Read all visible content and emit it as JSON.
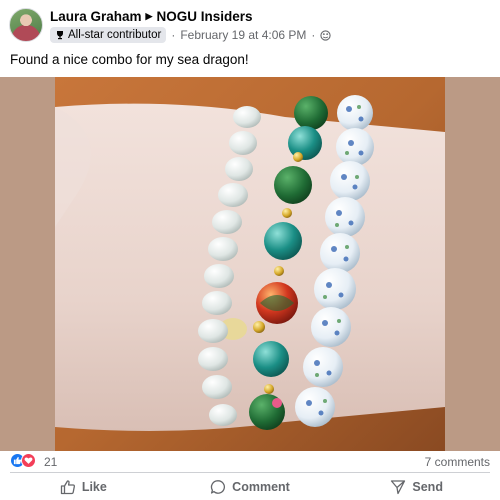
{
  "post": {
    "author": "Laura Graham",
    "group": "NOGU Insiders",
    "badge": "All-star contributor",
    "timestamp": "February 19 at 4:06 PM",
    "caption": "Found a nice combo for my sea dragon!"
  },
  "photo": {
    "subject": "Wrist wearing a stack of three beaded bracelets"
  },
  "stats": {
    "reactions_count": "21",
    "comments": "7 comments"
  },
  "actions": {
    "like": "Like",
    "comment": "Comment",
    "send": "Send"
  },
  "colors": {
    "like_blue": "#1877f2",
    "love_red": "#f33e58",
    "secondary_text": "#65676b"
  }
}
